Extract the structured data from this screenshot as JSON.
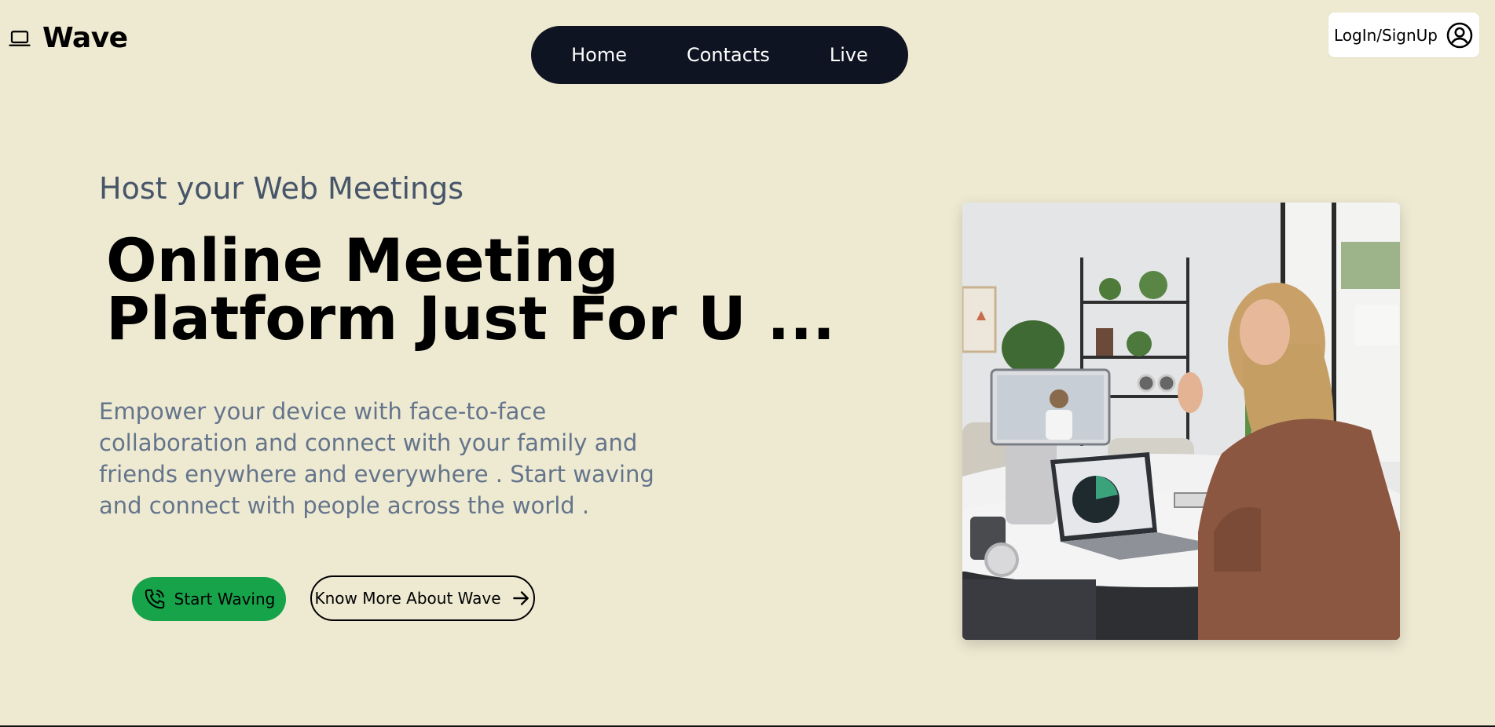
{
  "brand": {
    "name": "Wave",
    "icon": "laptop-icon"
  },
  "nav": {
    "items": [
      {
        "label": "Home"
      },
      {
        "label": "Contacts"
      },
      {
        "label": "Live"
      }
    ]
  },
  "auth": {
    "label": "LogIn/SignUp",
    "icon": "user-circle-icon"
  },
  "hero": {
    "subtitle": "Host your Web Meetings",
    "headline_line1": "Online Meeting",
    "headline_line2": "Platform Just For U ...",
    "description": "Empower your device with face-to-face collaboration and connect with your family and friends enywhere and everywhere . Start waving and connect with people across the world .",
    "primary_button": {
      "label": "Start Waving",
      "icon": "phone-icon"
    },
    "secondary_button": {
      "label": "Know More About Wave",
      "icon": "arrow-right-icon"
    },
    "image": "woman-video-call-photo"
  },
  "colors": {
    "background": "#EEEAD2",
    "nav_bg": "#0E1421",
    "accent_green": "#16A34A",
    "subtitle": "#475569",
    "description": "#64748B"
  }
}
